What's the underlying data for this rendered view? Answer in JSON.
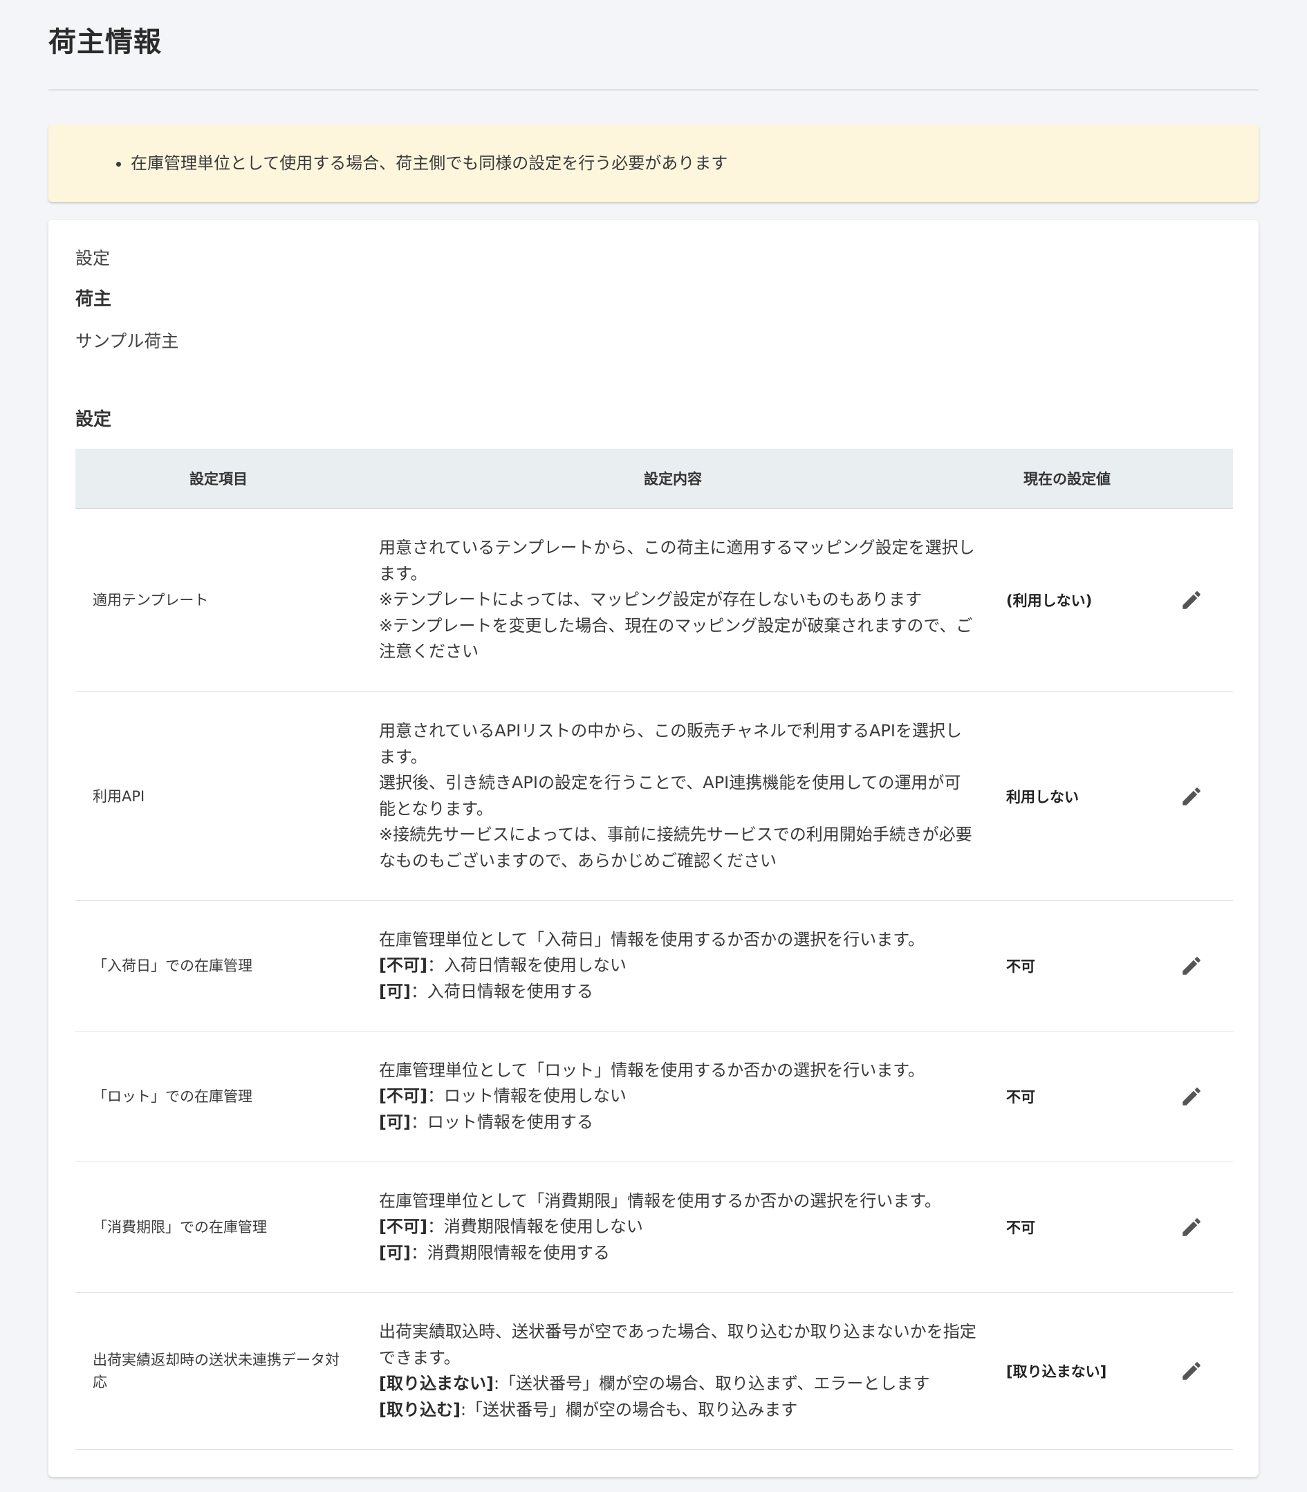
{
  "page": {
    "title": "荷主情報"
  },
  "notice": {
    "items": [
      "在庫管理単位として使用する場合、荷主側でも同様の設定を行う必要があります"
    ]
  },
  "card": {
    "caption": "設定",
    "shipper_label": "荷主",
    "shipper_value": "サンプル荷主",
    "settings_label": "設定"
  },
  "table": {
    "headers": {
      "item": "設定項目",
      "description": "設定内容",
      "current_value": "現在の設定値"
    },
    "rows": [
      {
        "item": "適用テンプレート",
        "desc": [
          "用意されているテンプレートから、この荷主に適用するマッピング設定を選択します。",
          "※テンプレートによっては、マッピング設定が存在しないものもあります",
          "※テンプレートを変更した場合、現在のマッピング設定が破棄されますので、ご注意ください"
        ],
        "value": "(利用しない)",
        "action_icon": "pencil-icon"
      },
      {
        "item": "利用API",
        "desc": [
          "用意されているAPIリストの中から、この販売チャネルで利用するAPIを選択します。",
          "選択後、引き続きAPIの設定を行うことで、API連携機能を使用しての運用が可能となります。",
          "※接続先サービスによっては、事前に接続先サービスでの利用開始手続きが必要なものもございますので、あらかじめご確認ください"
        ],
        "value": "利用しない",
        "action_icon": "pencil-icon"
      },
      {
        "item": "「入荷日」での在庫管理",
        "desc": [
          "在庫管理単位として「入荷日」情報を使用するか否かの選択を行います。"
        ],
        "opts": [
          {
            "key": "[不可]",
            "text": "：入荷日情報を使用しない"
          },
          {
            "key": "[可]",
            "text": "：入荷日情報を使用する"
          }
        ],
        "value": "不可",
        "action_icon": "pencil-icon"
      },
      {
        "item": "「ロット」での在庫管理",
        "desc": [
          "在庫管理単位として「ロット」情報を使用するか否かの選択を行います。"
        ],
        "opts": [
          {
            "key": "[不可]",
            "text": "：ロット情報を使用しない"
          },
          {
            "key": "[可]",
            "text": "：ロット情報を使用する"
          }
        ],
        "value": "不可",
        "action_icon": "pencil-icon"
      },
      {
        "item": "「消費期限」での在庫管理",
        "desc": [
          "在庫管理単位として「消費期限」情報を使用するか否かの選択を行います。"
        ],
        "opts": [
          {
            "key": "[不可]",
            "text": "：消費期限情報を使用しない"
          },
          {
            "key": "[可]",
            "text": "：消費期限情報を使用する"
          }
        ],
        "value": "不可",
        "action_icon": "pencil-icon"
      },
      {
        "item": "出荷実績返却時の送状未連携データ対応",
        "desc": [
          "出荷実績取込時、送状番号が空であった場合、取り込むか取り込まないかを指定できます。"
        ],
        "opts": [
          {
            "key": "[取り込まない]",
            "text": ":「送状番号」欄が空の場合、取り込まず、エラーとします"
          },
          {
            "key": "[取り込む]",
            "text": ":「送状番号」欄が空の場合も、取り込みます"
          }
        ],
        "value": "[取り込まない]",
        "action_icon": "pencil-icon"
      }
    ]
  }
}
